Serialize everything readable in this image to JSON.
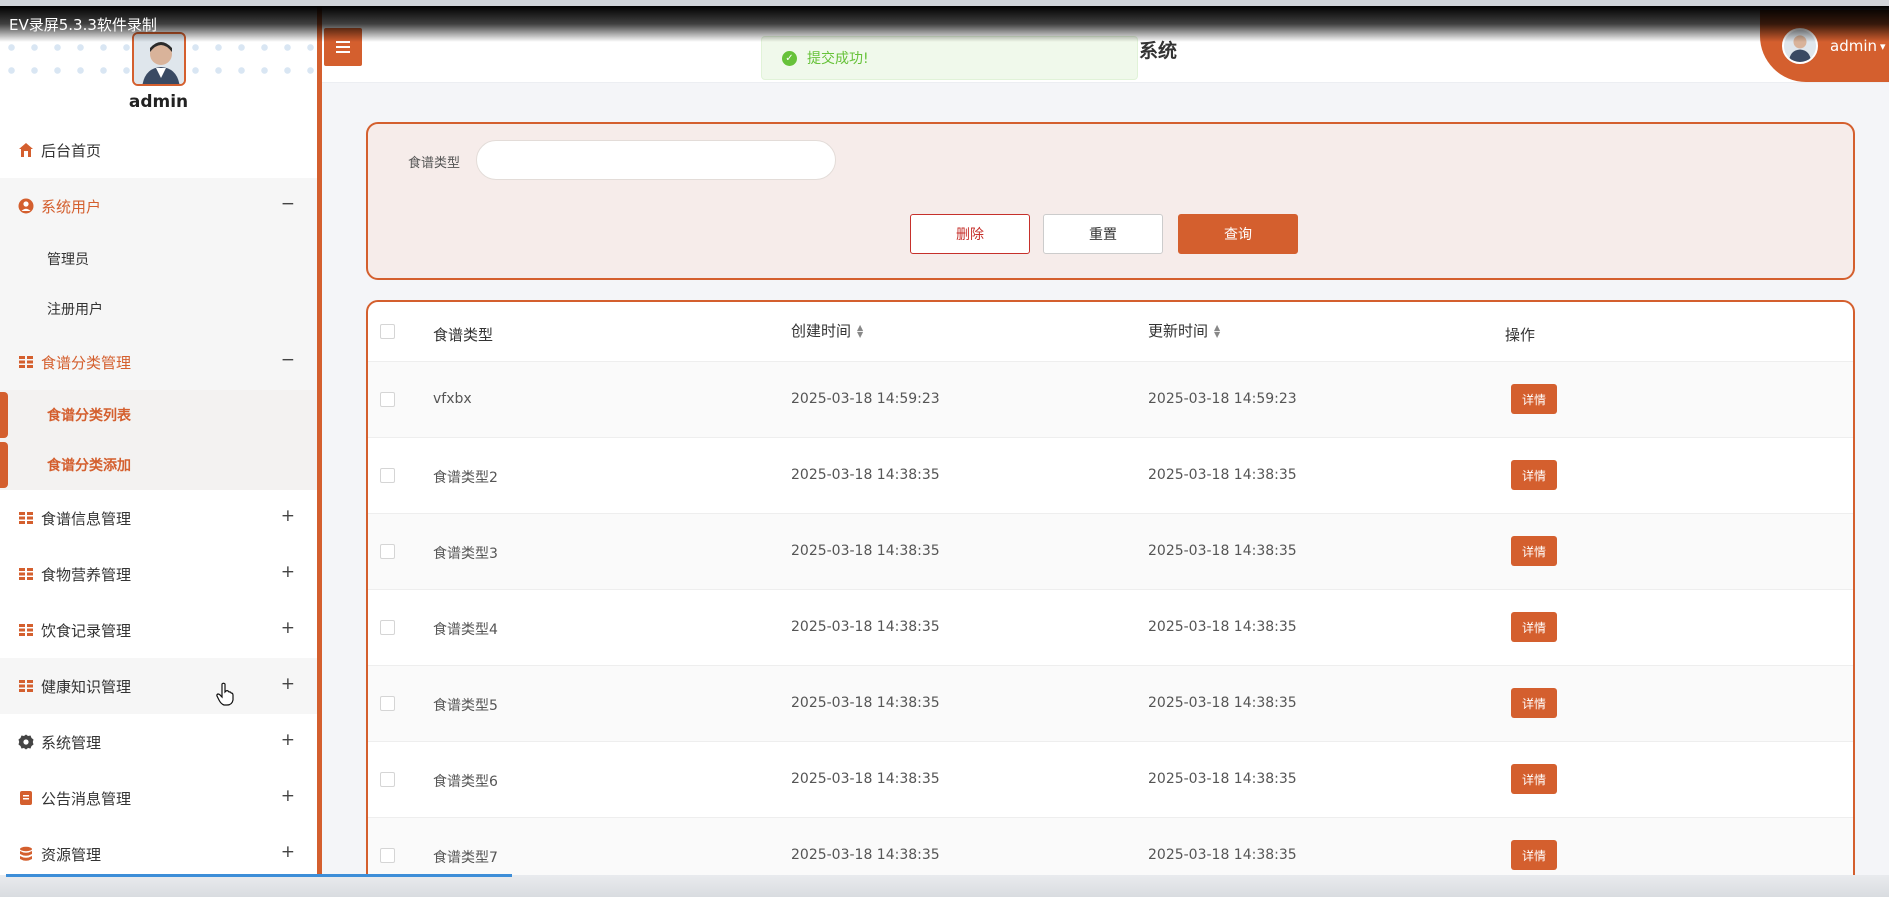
{
  "recorder": {
    "title": "EV录屏5.3.3软件录制"
  },
  "header": {
    "title_fragment": "系统",
    "toast": "提交成功!",
    "user": "admin"
  },
  "sidebar": {
    "username": "admin",
    "items": [
      {
        "label": "后台首页"
      },
      {
        "label": "系统用户",
        "toggle": "−"
      },
      {
        "label": "食谱分类管理",
        "toggle": "−"
      },
      {
        "label": "食谱信息管理",
        "toggle": "+"
      },
      {
        "label": "食物营养管理",
        "toggle": "+"
      },
      {
        "label": "饮食记录管理",
        "toggle": "+"
      },
      {
        "label": "健康知识管理",
        "toggle": "+"
      },
      {
        "label": "系统管理",
        "toggle": "+"
      },
      {
        "label": "公告消息管理",
        "toggle": "+"
      },
      {
        "label": "资源管理",
        "toggle": "+"
      }
    ],
    "sub_users": [
      "管理员",
      "注册用户"
    ],
    "sub_recipe_category": [
      "食谱分类列表",
      "食谱分类添加"
    ]
  },
  "search": {
    "label": "食谱类型",
    "value": "",
    "placeholder": "",
    "delete": "删除",
    "reset": "重置",
    "query": "查询"
  },
  "table": {
    "headers": [
      "食谱类型",
      "创建时间",
      "更新时间",
      "操作"
    ],
    "action_label": "详情",
    "rows": [
      {
        "type": "vfxbx",
        "created": "2025-03-18 14:59:23",
        "updated": "2025-03-18 14:59:23"
      },
      {
        "type": "食谱类型2",
        "created": "2025-03-18 14:38:35",
        "updated": "2025-03-18 14:38:35"
      },
      {
        "type": "食谱类型3",
        "created": "2025-03-18 14:38:35",
        "updated": "2025-03-18 14:38:35"
      },
      {
        "type": "食谱类型4",
        "created": "2025-03-18 14:38:35",
        "updated": "2025-03-18 14:38:35"
      },
      {
        "type": "食谱类型5",
        "created": "2025-03-18 14:38:35",
        "updated": "2025-03-18 14:38:35"
      },
      {
        "type": "食谱类型6",
        "created": "2025-03-18 14:38:35",
        "updated": "2025-03-18 14:38:35"
      },
      {
        "type": "食谱类型7",
        "created": "2025-03-18 14:38:35",
        "updated": "2025-03-18 14:38:35"
      }
    ]
  },
  "colors": {
    "accent": "#d45f2e",
    "panel_bg": "#f6ecea",
    "success": "#67c23a",
    "danger": "#c6302b"
  },
  "icons": [
    "home-icon",
    "user-circle-icon",
    "grid-icon",
    "gear-icon",
    "document-icon",
    "database-icon",
    "menu-icon",
    "check-circle-icon",
    "sort-icon",
    "chevron-down-icon"
  ]
}
